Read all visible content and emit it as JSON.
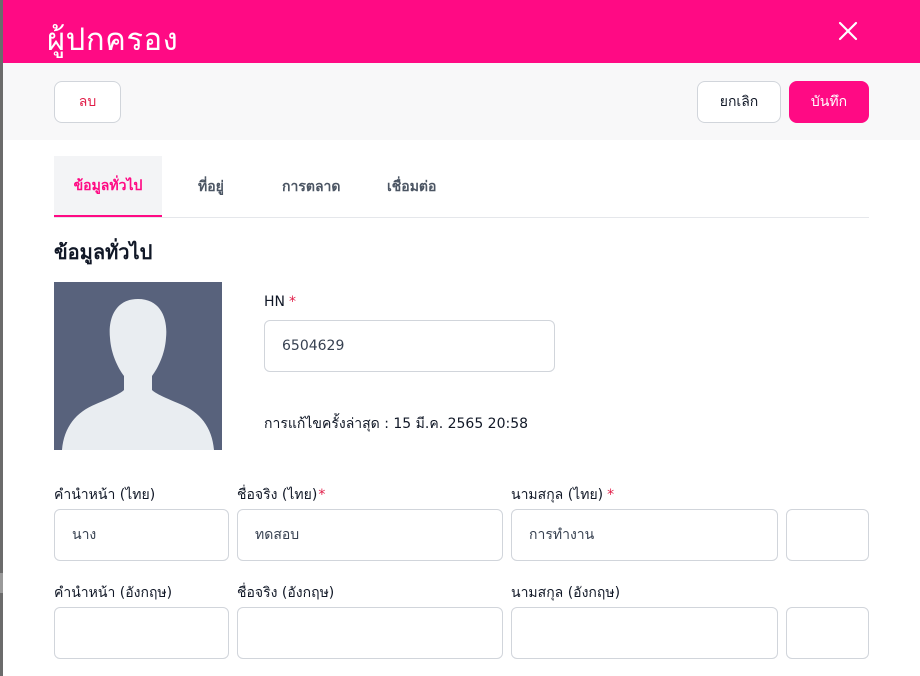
{
  "header": {
    "title": "ผู้ปกครอง",
    "close_icon": "close-icon"
  },
  "toolbar": {
    "delete_label": "ลบ",
    "cancel_label": "ยกเลิก",
    "save_label": "บันทึก"
  },
  "tabs": [
    {
      "label": "ข้อมูลทั่วไป",
      "active": true
    },
    {
      "label": "ที่อยู่",
      "active": false
    },
    {
      "label": "การตลาด",
      "active": false
    },
    {
      "label": "เชื่อมต่อ",
      "active": false
    }
  ],
  "section": {
    "title": "ข้อมูลทั่วไป"
  },
  "hn": {
    "label": "HN",
    "value": "6504629"
  },
  "last_edited": "การแก้ไขครั้งล่าสุด : 15 มี.ค. 2565 20:58",
  "thai_name": {
    "prefix_label": "คำนำหน้า (ไทย)",
    "prefix_value": "นาง",
    "first_label": "ชื่อจริง (ไทย)",
    "first_value": "ทดสอบ",
    "last_label": "นามสกุล (ไทย)",
    "last_value": "การทำงาน"
  },
  "eng_name": {
    "prefix_label": "คำนำหน้า (อังกฤษ)",
    "prefix_value": "",
    "first_label": "ชื่อจริง (อังกฤษ)",
    "first_value": "",
    "last_label": "นามสกุล (อังกฤษ)",
    "last_value": ""
  },
  "colors": {
    "brand": "#ff0a84",
    "required": "#e11d48",
    "avatar_bg": "#58627c"
  }
}
